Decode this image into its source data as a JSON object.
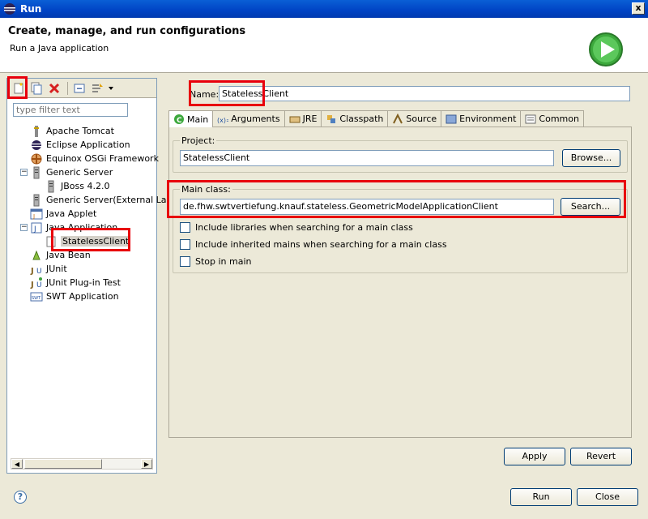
{
  "window": {
    "title": "Run",
    "close_glyph": "x"
  },
  "header": {
    "title": "Create, manage, and run configurations",
    "subtitle": "Run a Java application"
  },
  "left": {
    "filter_placeholder": "type filter text",
    "tree": [
      {
        "label": "Apache Tomcat",
        "icon": "tomcat-icon"
      },
      {
        "label": "Eclipse Application",
        "icon": "eclipse-icon"
      },
      {
        "label": "Equinox OSGi Framework",
        "icon": "osgi-icon"
      },
      {
        "label": "Generic Server",
        "icon": "server-icon"
      },
      {
        "label": "JBoss 4.2.0",
        "icon": "server-icon"
      },
      {
        "label": "Generic Server(External La",
        "icon": "server-icon"
      },
      {
        "label": "Java Applet",
        "icon": "applet-icon"
      },
      {
        "label": "Java Application",
        "icon": "java-app-icon"
      },
      {
        "label": "StatelessClient",
        "icon": "java-config-icon"
      },
      {
        "label": "Java Bean",
        "icon": "bean-icon"
      },
      {
        "label": "JUnit",
        "icon": "junit-icon"
      },
      {
        "label": "JUnit Plug-in Test",
        "icon": "junit-plugin-icon"
      },
      {
        "label": "SWT Application",
        "icon": "swt-icon"
      }
    ]
  },
  "right": {
    "name_label": "Name:",
    "name_value": "StatelessClient",
    "tabs": [
      "Main",
      "Arguments",
      "JRE",
      "Classpath",
      "Source",
      "Environment",
      "Common"
    ],
    "project_label": "Project:",
    "project_value": "StatelessClient",
    "browse_label": "Browse...",
    "main_class_label": "Main class:",
    "main_class_value": "de.fhw.swtvertiefung.knauf.stateless.GeometricModelApplicationClient",
    "search_label": "Search...",
    "checkboxes": [
      {
        "label": "Include libraries when searching for a main class",
        "checked": false
      },
      {
        "label": "Include inherited mains when searching for a main class",
        "checked": false
      },
      {
        "label": "Stop in main",
        "checked": false
      }
    ],
    "apply_label": "Apply",
    "revert_label": "Revert"
  },
  "footer": {
    "run_label": "Run",
    "close_label": "Close",
    "help_glyph": "?"
  },
  "colors": {
    "highlight_red": "#e8000c",
    "titlebar_blue": "#0a5fd6"
  }
}
